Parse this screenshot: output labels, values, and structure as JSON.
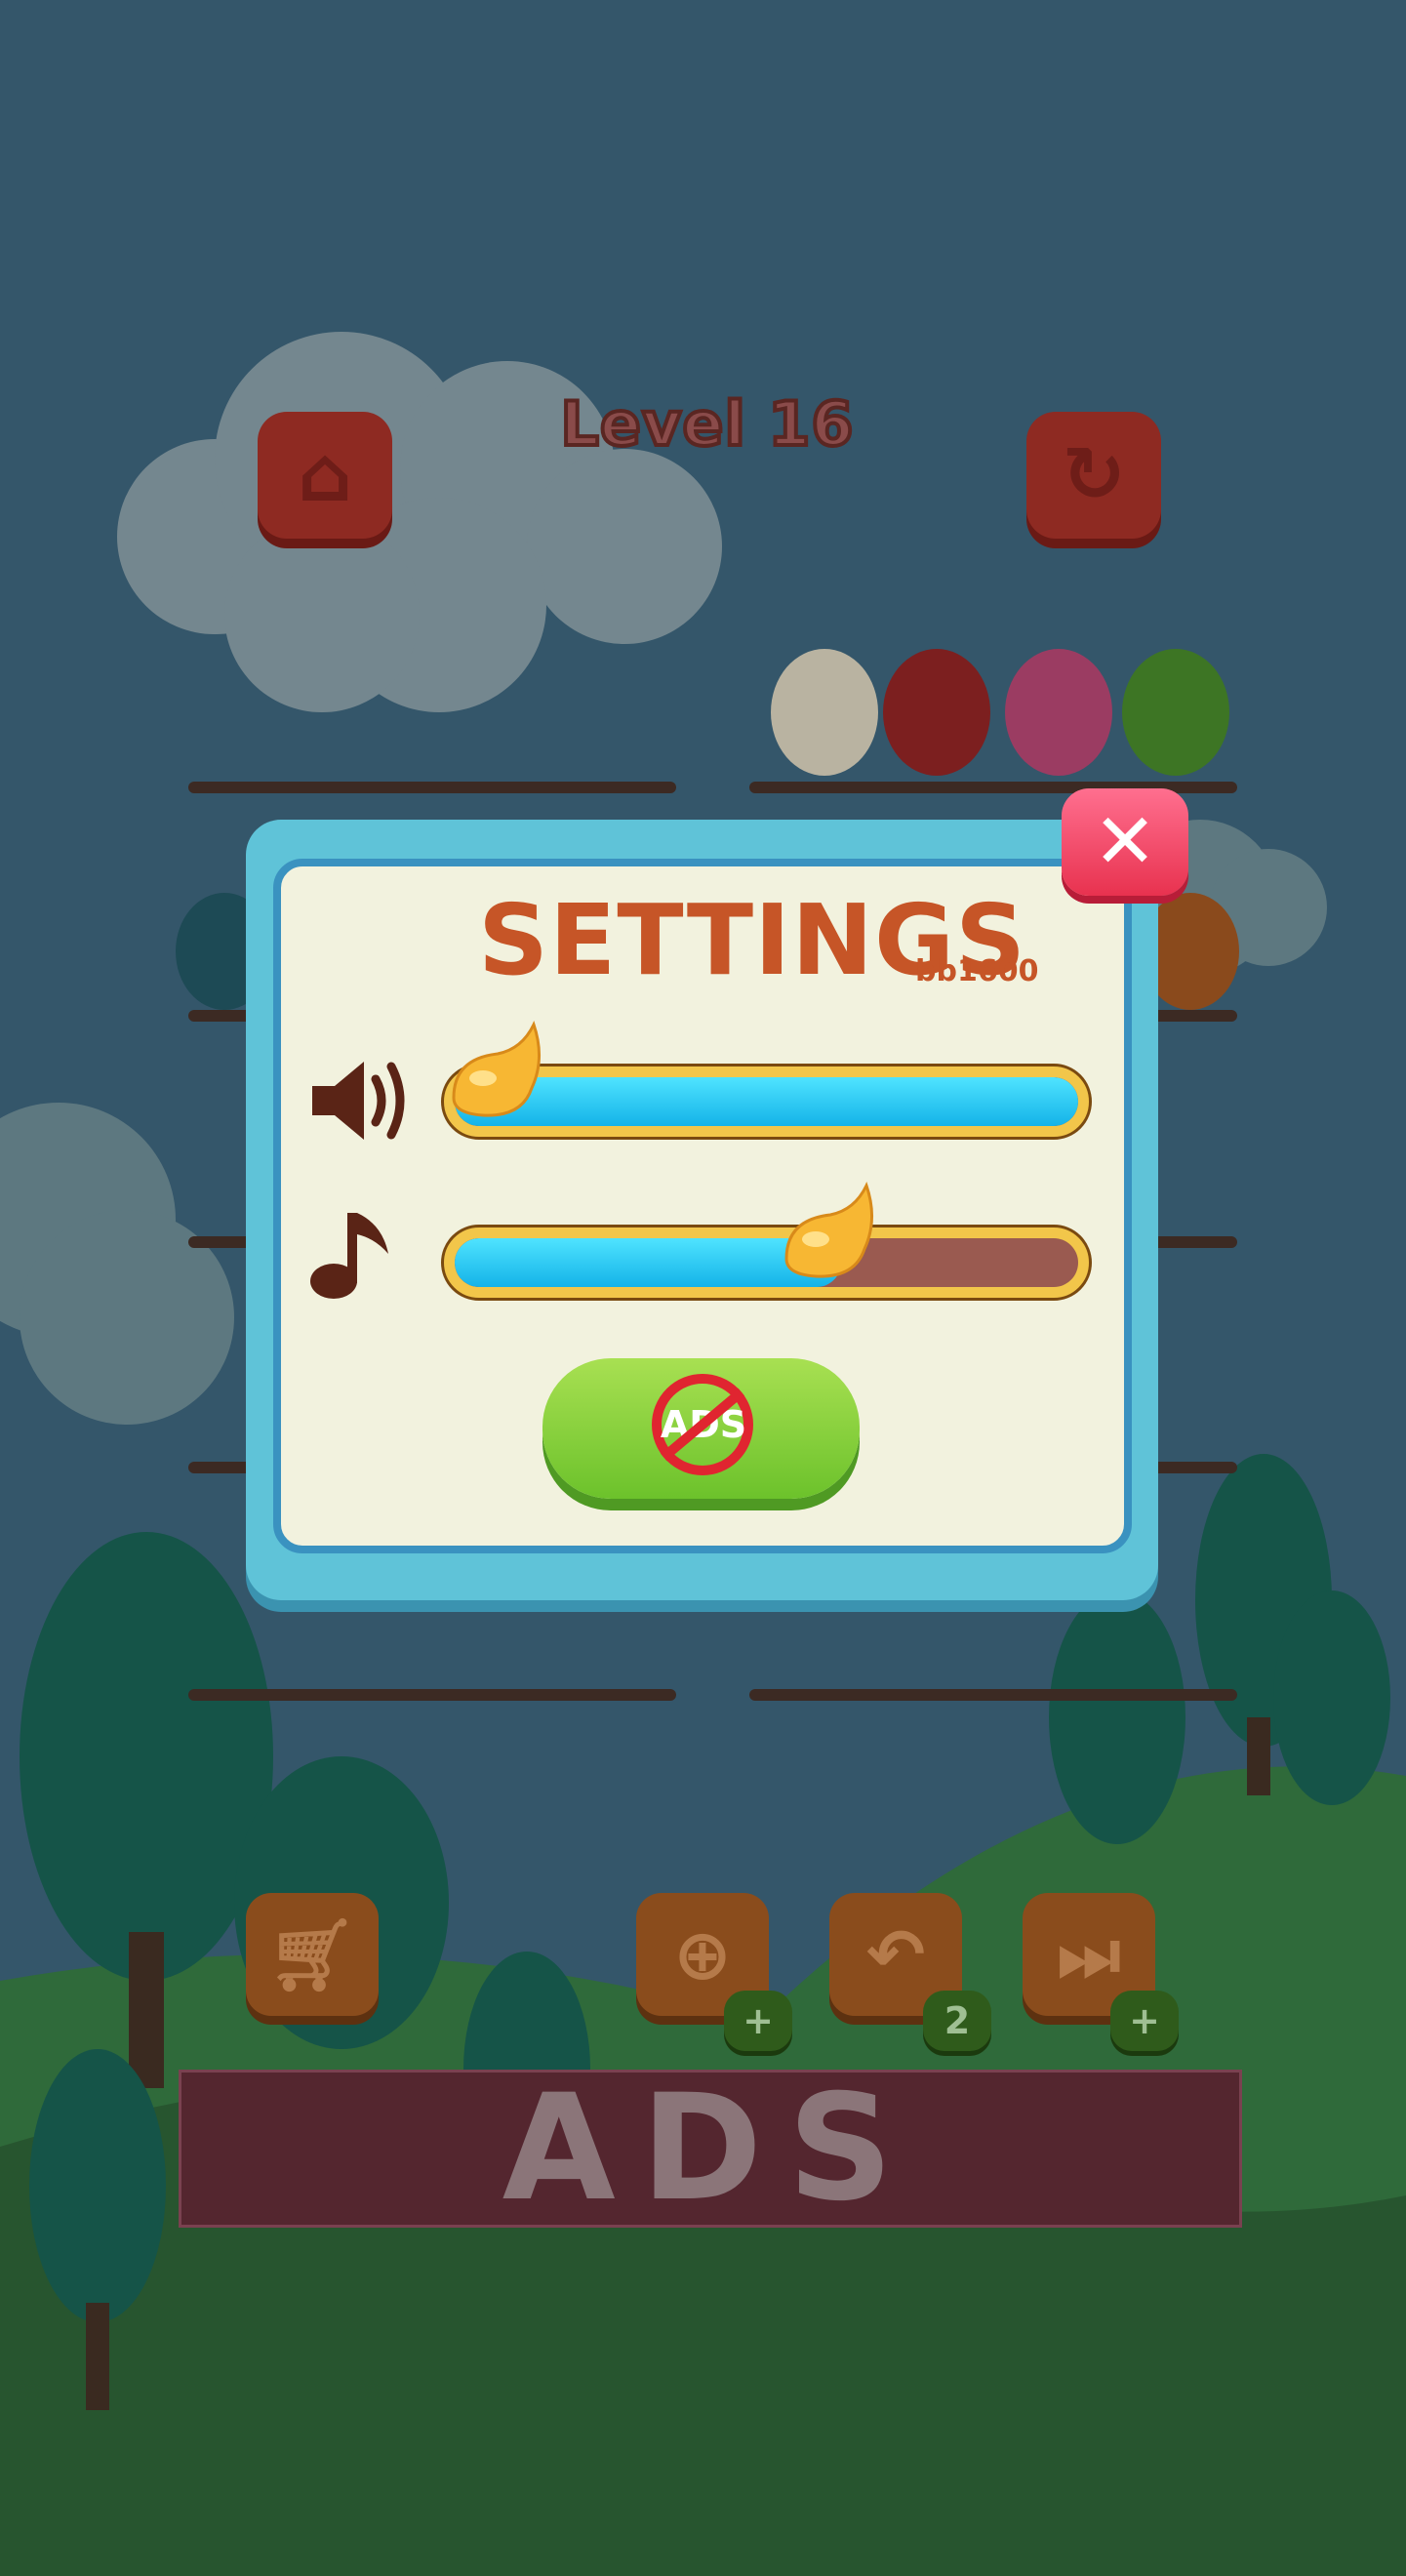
{
  "header": {
    "level_title": "Level 16"
  },
  "top_buttons": {
    "home_icon": "home-icon",
    "restart_icon": "restart-icon"
  },
  "settings": {
    "title": "SETTINGS",
    "subtitle": "bb1600",
    "sound": {
      "icon": "speaker-icon",
      "level": 0.02
    },
    "music": {
      "icon": "music-note-icon",
      "level": 0.62
    },
    "no_ads_label": "ADS",
    "close_icon": "close-icon"
  },
  "toolbar": {
    "shop_icon": "cart-icon",
    "add_branch_icon": "add-branch-icon",
    "undo_icon": "undo-icon",
    "undo_count": "2",
    "skip_icon": "skip-icon"
  },
  "ads_banner": {
    "text": "ADS"
  },
  "colors": {
    "dialog_frame": "#5fc3d8",
    "dialog_panel": "#f2f2de",
    "title_orange": "#c65527",
    "slider_fill": "#22c4ef",
    "close_pink": "#f0405f",
    "noads_green": "#8bd33a"
  }
}
